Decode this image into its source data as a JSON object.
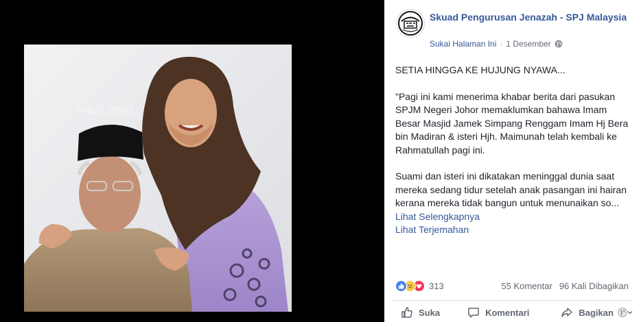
{
  "photo": {
    "watermark": "rrazi.com."
  },
  "post": {
    "page_name": "Skuad Pengurusan Jenazah - SPJ Malaysia",
    "like_page": "Sukai Halaman Ini",
    "separator": "·",
    "date": "1 Desember",
    "text": {
      "headline": "SETIA HINGGA KE HUJUNG NYAWA...",
      "paragraph1": "\"Pagi ini kami menerima khabar berita dari pasukan SPJM Negeri Johor memaklumkan bahawa Imam Besar Masjid Jamek Simpang Renggam Imam Hj Bera bin Madiran & isteri Hjh. Maimunah telah kembali ke Rahmatullah pagi ini.",
      "paragraph2": "Suami dan isteri ini dikatakan meninggal dunia saat mereka sedang tidur setelah anak pasangan ini hairan kerana mereka tidak bangun untuk menunaikan so...",
      "see_more": "Lihat Selengkapnya",
      "translate": "Lihat Terjemahan"
    },
    "reactions": {
      "count": "313"
    },
    "comments": "55 Komentar",
    "shares": "96 Kali Dibagikan",
    "actions": {
      "like": "Suka",
      "comment": "Komentari",
      "share": "Bagikan"
    }
  }
}
